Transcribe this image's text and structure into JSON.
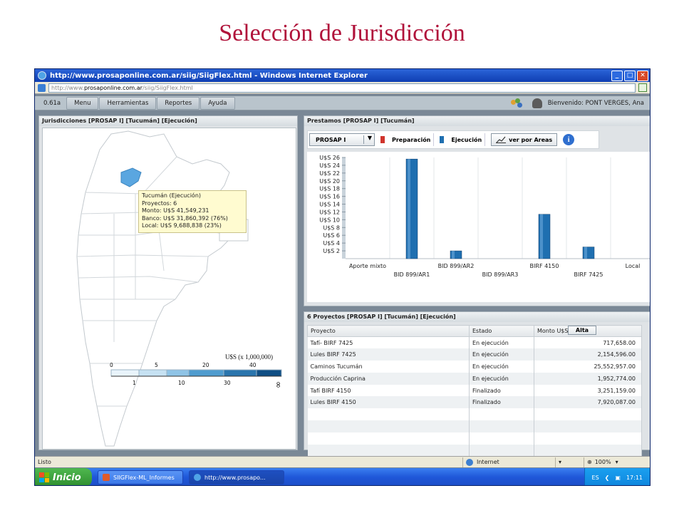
{
  "slide": {
    "title": "Selección de Jurisdicción"
  },
  "browser": {
    "title": "http://www.prosaponline.com.ar/siig/SiigFlex.html - Windows Internet Explorer",
    "address_prefix": "http://www.",
    "address_host": "prosaponline.com.ar",
    "address_path": "/siig/SiigFlex.html",
    "status_left": "Listo",
    "zone": "Internet",
    "zoom": "100%"
  },
  "app": {
    "version": "0.61a",
    "menu": [
      "Menu",
      "Herramientas",
      "Reportes",
      "Ayuda"
    ],
    "welcome": "Bienvenido: PONT VERGES, Ana"
  },
  "map_panel": {
    "title": "Jurisdicciones [PROSAP I] [Tucumán] [Ejecución]",
    "tooltip": {
      "line1": "Tucumán (Ejecución)",
      "line2": "Proyectos: 6",
      "line3": "Monto: U$S 41,549,231",
      "line4": "Banco: U$S 31,860,392 (76%)",
      "line5": "Local: U$S 9,688,838 (23%)"
    },
    "legend": {
      "title": "U$S (x 1,000,000)",
      "top_ticks": [
        "0",
        "5",
        "20",
        "40"
      ],
      "bottom_ticks": [
        "1",
        "10",
        "30",
        "∞"
      ],
      "colors": [
        "#e9f4fb",
        "#c6e2f3",
        "#8fc4e6",
        "#4f9ccf",
        "#2a75ad",
        "#0f4e84"
      ]
    },
    "highlight_color": "#5aa6e0"
  },
  "loans_panel": {
    "title": "Prestamos [PROSAP I] [Tucumán]",
    "combo_value": "PROSAP I",
    "legend_prep": "Preparación",
    "legend_exec": "Ejecución",
    "areas_button": "ver por Areas",
    "info_button": "i",
    "prep_color": "#d0342c",
    "exec_color": "#1f6fb0"
  },
  "chart_data": {
    "type": "bar",
    "categories": [
      "Aporte mixto",
      "BID 899/AR1",
      "BID 899/AR2",
      "BID 899/AR3",
      "BIRF 4150",
      "BIRF 7425",
      "Local"
    ],
    "series": [
      {
        "name": "Ejecución",
        "values": [
          0,
          25.6,
          2.0,
          0,
          11.4,
          3.0,
          0
        ]
      }
    ],
    "ylim": [
      0,
      26
    ],
    "yticks": [
      2,
      4,
      6,
      8,
      10,
      12,
      14,
      16,
      18,
      20,
      22,
      24,
      26
    ],
    "ytick_labels": [
      "U$S 2",
      "U$S 4",
      "U$S 6",
      "U$S 8",
      "U$S 10",
      "U$S 12",
      "U$S 14",
      "U$S 16",
      "U$S 18",
      "U$S 20",
      "U$S 22",
      "U$S 24",
      "U$S 26"
    ],
    "grid": true,
    "xlabel": "",
    "ylabel": ""
  },
  "projects_panel": {
    "title": "6 Proyectos [PROSAP I] [Tucumán] [Ejecución]",
    "columns": [
      "Proyecto",
      "Estado",
      "Monto U$S"
    ],
    "alta_button": "Alta",
    "rows": [
      [
        "Tafí- BIRF 7425",
        "En ejecución",
        "717,658.00"
      ],
      [
        "Lules BIRF 7425",
        "En ejecución",
        "2,154,596.00"
      ],
      [
        "Caminos Tucumán",
        "En ejecución",
        "25,552,957.00"
      ],
      [
        "Producción Caprina",
        "En ejecución",
        "1,952,774.00"
      ],
      [
        "Tafí BIRF 4150",
        "Finalizado",
        "3,251,159.00"
      ],
      [
        "Lules BIRF 4150",
        "Finalizado",
        "7,920,087.00"
      ],
      [
        "",
        "",
        ""
      ],
      [
        "",
        "",
        ""
      ],
      [
        "",
        "",
        ""
      ],
      [
        "",
        "",
        ""
      ]
    ]
  },
  "taskbar": {
    "start": "Inicio",
    "task1": "SIIGFlex-ML_Informes",
    "task2": "http://www.prosapo...",
    "lang": "ES",
    "clock": "17:11"
  }
}
